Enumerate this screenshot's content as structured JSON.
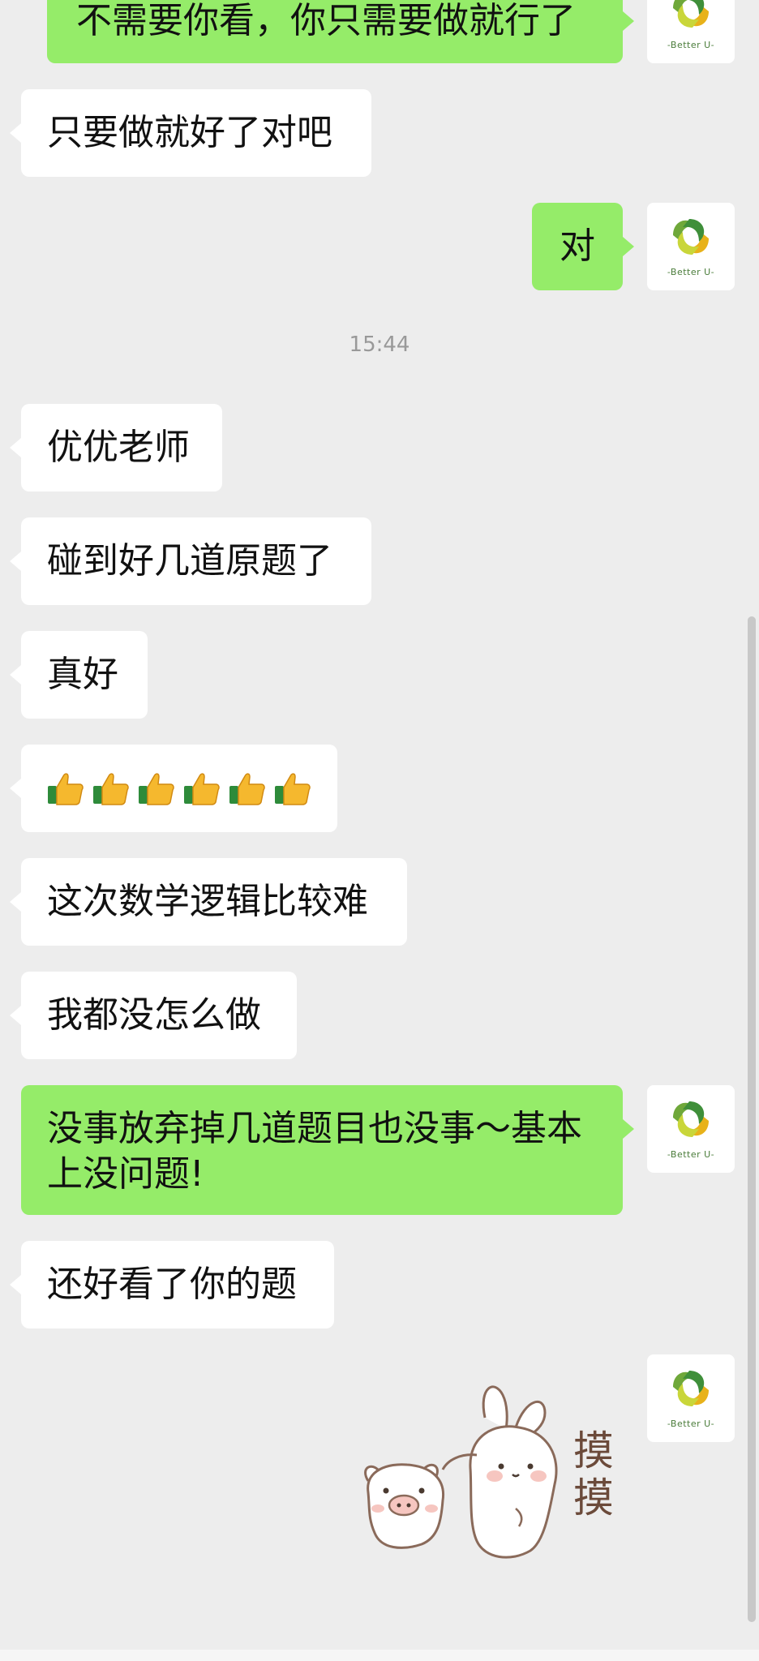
{
  "messages": [
    {
      "side": "right",
      "text": "不需要你看，你只需要做就行了"
    },
    {
      "side": "left",
      "text": "只要做就好了对吧"
    },
    {
      "side": "right",
      "text": "对"
    },
    {
      "side": "left",
      "text": "优优老师"
    },
    {
      "side": "left",
      "text": "碰到好几道原题了"
    },
    {
      "side": "left",
      "text": "真好"
    },
    {
      "side": "left",
      "emoji": "thumbs-up-icon",
      "count": 6
    },
    {
      "side": "left",
      "text": "这次数学逻辑比较难"
    },
    {
      "side": "left",
      "text": "我都没怎么做"
    },
    {
      "side": "right",
      "text": "没事放弃掉几道题目也没事～基本上没问题!"
    },
    {
      "side": "left",
      "text": "还好看了你的题"
    },
    {
      "side": "right",
      "sticker": "pig-and-rabbit-sticker",
      "sticker_text": "摸摸"
    }
  ],
  "timestamp": "15:44",
  "avatar": {
    "caption": "-Better U-",
    "logo": "leaf-swirl-logo-icon"
  },
  "colors": {
    "background": "#ededed",
    "bubble_self": "#95ec69",
    "bubble_other": "#ffffff"
  }
}
